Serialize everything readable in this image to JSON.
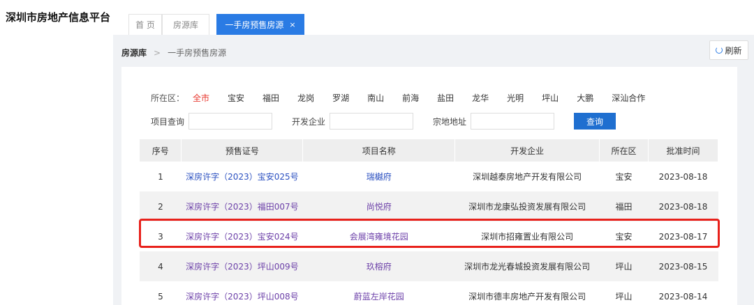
{
  "app": {
    "title": "深圳市房地产信息平台"
  },
  "tabs": [
    {
      "label": "首 页"
    },
    {
      "label": "房源库"
    },
    {
      "label": "一手房预售房源",
      "close": "×"
    }
  ],
  "breadcrumb": {
    "root": "房源库",
    "separator": ">",
    "current": "一手房预售房源"
  },
  "refresh": {
    "label": "刷新"
  },
  "filters": {
    "district_label": "所在区：",
    "districts": [
      "全市",
      "宝安",
      "福田",
      "龙岗",
      "罗湖",
      "南山",
      "前海",
      "盐田",
      "龙华",
      "光明",
      "坪山",
      "大鹏",
      "深汕合作"
    ],
    "project_label": "项目查询",
    "developer_label": "开发企业",
    "land_label": "宗地地址",
    "project_value": "",
    "developer_value": "",
    "land_value": "",
    "search_label": "查询"
  },
  "table": {
    "headers": [
      "序号",
      "预售证号",
      "项目名称",
      "开发企业",
      "所在区",
      "批准时间"
    ],
    "rows": [
      {
        "no": "1",
        "cert": "深房许字（2023）宝安025号",
        "project": "瑞樾府",
        "developer": "深圳越泰房地产开发有限公司",
        "district": "宝安",
        "date": "2023-08-18"
      },
      {
        "no": "2",
        "cert": "深房许字（2023）福田007号",
        "project": "尚悦府",
        "developer": "深圳市龙康弘投资发展有限公司",
        "district": "福田",
        "date": "2023-08-18"
      },
      {
        "no": "3",
        "cert": "深房许字（2023）宝安024号",
        "project": "会展湾雍境花园",
        "developer": "深圳市招雍置业有限公司",
        "district": "宝安",
        "date": "2023-08-17"
      },
      {
        "no": "4",
        "cert": "深房许字（2023）坪山009号",
        "project": "玖榕府",
        "developer": "深圳市龙光春城投资发展有限公司",
        "district": "坪山",
        "date": "2023-08-15"
      },
      {
        "no": "5",
        "cert": "深房许字（2023）坪山008号",
        "project": "蔚蓝左岸花园",
        "developer": "深圳市德丰房地产开发有限公司",
        "district": "坪山",
        "date": "2023-08-14"
      }
    ]
  },
  "colors": {
    "accent": "#2a7be4",
    "active_district": "#e8382f",
    "highlight": "#e8211b",
    "link": "#6b3fa8"
  }
}
